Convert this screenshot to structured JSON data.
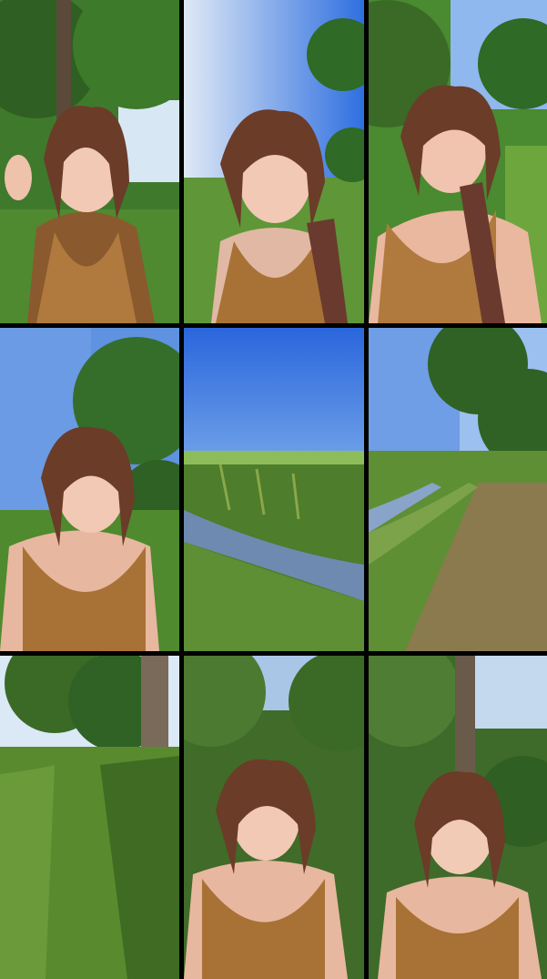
{
  "grid": {
    "columns": 3,
    "rows": 3
  },
  "tiles": [
    {
      "scene": "woman-waving-under-trees",
      "top": "#2f5f2a",
      "bottom": "#5a8a34",
      "sky": "#cfe3f2"
    },
    {
      "scene": "woman-talking-blue-sky-field",
      "top": "#6fa4e8",
      "bottom": "#6b9a3a",
      "sky": "#3b78e0"
    },
    {
      "scene": "woman-smiling-trees-bright-sky",
      "top": "#4a7a32",
      "bottom": "#6d9c3d",
      "sky": "#8fb8ee"
    },
    {
      "scene": "woman-smiling-tree-and-field",
      "top": "#5e8fdb",
      "bottom": "#4f7f2c",
      "sky": "#5f92e0"
    },
    {
      "scene": "ditch-water-and-grass-field",
      "top": "#2f6fe0",
      "bottom": "#4e7d2b",
      "sky": "#3c7ae2"
    },
    {
      "scene": "ditch-and-tree-lined-path",
      "top": "#6f9de6",
      "bottom": "#6e8f3c",
      "sky": "#9cc0f0"
    },
    {
      "scene": "grassy-path-along-trees",
      "top": "#cfe0f2",
      "bottom": "#5a8a2e",
      "sky": "#dbe8f5"
    },
    {
      "scene": "woman-among-trees",
      "top": "#4b7a30",
      "bottom": "#406b28",
      "sky": "#a9c6e6"
    },
    {
      "scene": "woman-smiling-under-tree",
      "top": "#4f7d34",
      "bottom": "#3f6b2a",
      "sky": "#c4d9ee"
    }
  ]
}
